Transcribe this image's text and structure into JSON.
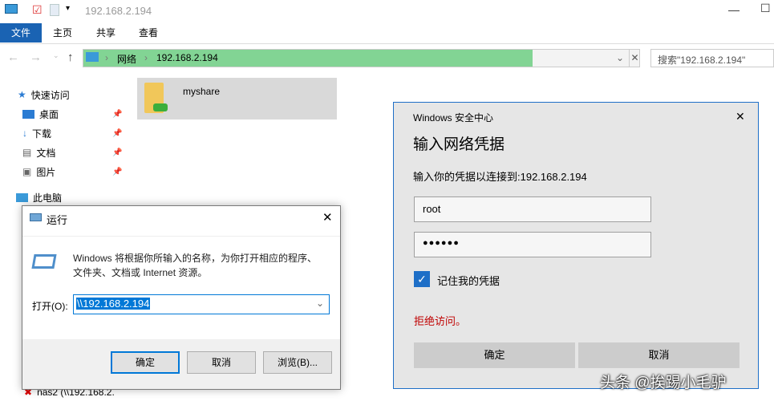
{
  "window": {
    "title": "192.168.2.194"
  },
  "ribbon": {
    "tabs": [
      "文件",
      "主页",
      "共享",
      "查看"
    ]
  },
  "address": {
    "segments": [
      "网络",
      "192.168.2.194"
    ],
    "search_placeholder": "搜索\"192.168.2.194\""
  },
  "sidebar": {
    "quick_access": "快速访问",
    "items": [
      "桌面",
      "下载",
      "文档",
      "图片"
    ],
    "this_pc": "此电脑",
    "nas": "nas2 (\\\\192.168.2."
  },
  "content": {
    "folder": "myshare"
  },
  "run_dialog": {
    "title": "运行",
    "description_1": "Windows 将根据你所输入的名称，为你打开相应的程序、",
    "description_2": "文件夹、文档或 Internet 资源。",
    "open_label": "打开(O):",
    "open_value": "\\\\192.168.2.194",
    "ok": "确定",
    "cancel": "取消",
    "browse": "浏览(B)..."
  },
  "security_dialog": {
    "app": "Windows 安全中心",
    "heading": "输入网络凭据",
    "prompt": "输入你的凭据以连接到:192.168.2.194",
    "username": "root",
    "password": "●●●●●●",
    "remember": "记住我的凭据",
    "remember_checked": true,
    "error": "拒绝访问。",
    "ok": "确定",
    "cancel": "取消",
    "error_color": "#c00000"
  },
  "watermark": "头条 @挨踢小毛驴"
}
